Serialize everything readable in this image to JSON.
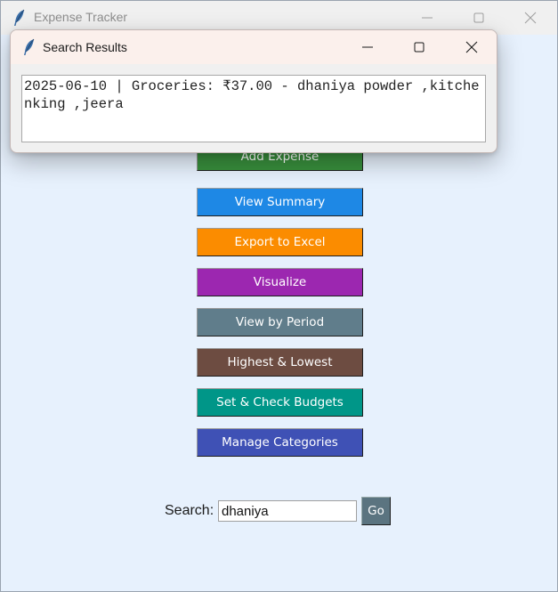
{
  "main_window": {
    "title": "Expense Tracker"
  },
  "buttons": [
    {
      "label": "Add Expense",
      "color": "#388e3c"
    },
    {
      "label": "View Summary",
      "color": "#1e88e5"
    },
    {
      "label": "Export to Excel",
      "color": "#fb8c00"
    },
    {
      "label": "Visualize",
      "color": "#9c27b0"
    },
    {
      "label": "View by Period",
      "color": "#607d8b"
    },
    {
      "label": "Highest & Lowest",
      "color": "#6d4c41"
    },
    {
      "label": "Set & Check Budgets",
      "color": "#009688"
    },
    {
      "label": "Manage Categories",
      "color": "#3f51b5"
    }
  ],
  "search": {
    "label": "Search:",
    "value": "dhaniya",
    "go_label": "Go"
  },
  "dialog": {
    "title": "Search Results",
    "result_text": "2025-06-10 | Groceries: ₹37.00 - dhaniya powder ,kitchenking ,jeera"
  }
}
